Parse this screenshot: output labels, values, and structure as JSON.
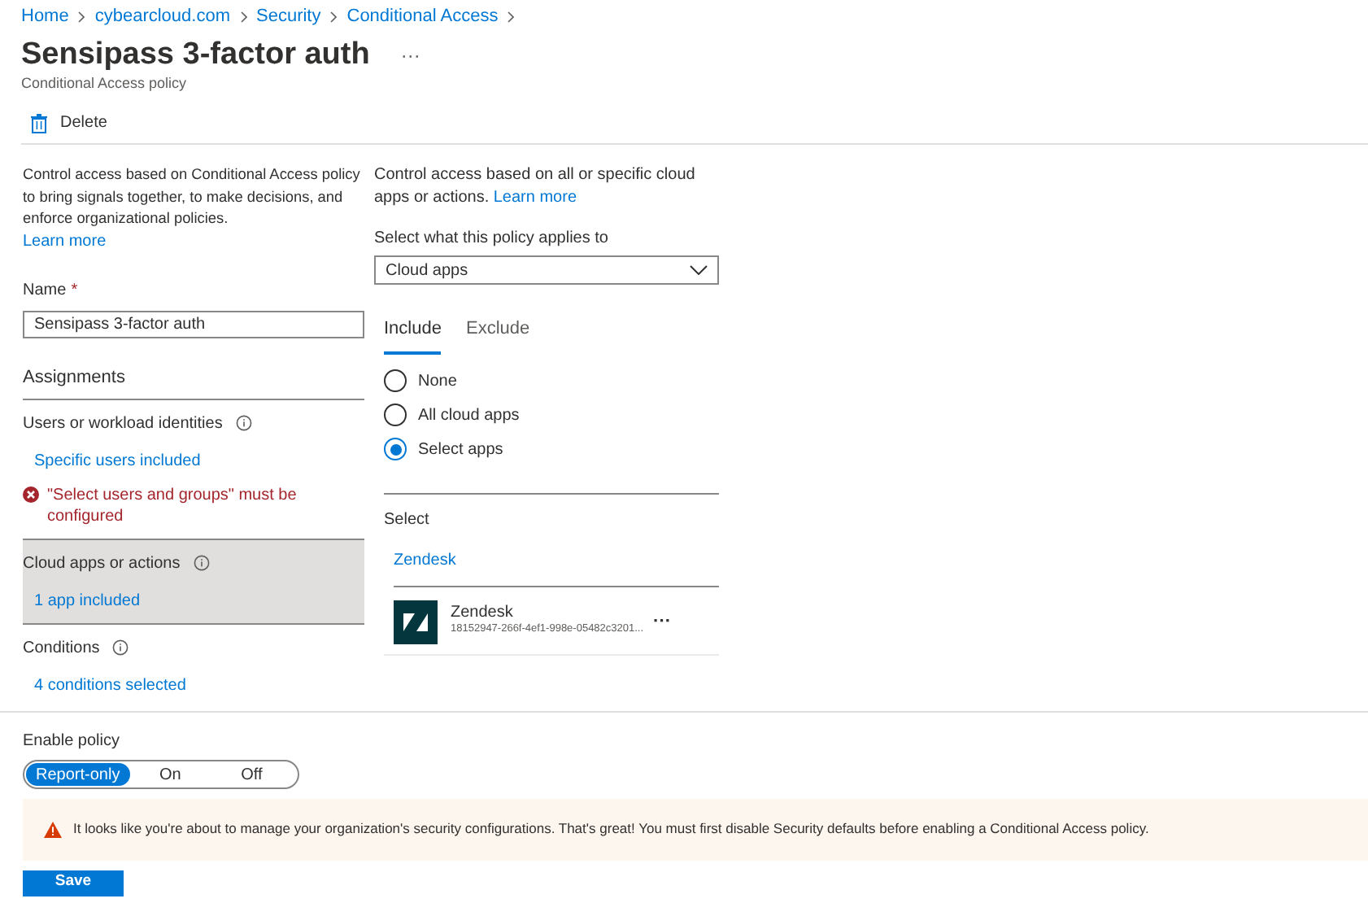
{
  "breadcrumb": [
    "Home",
    "cybearcloud.com",
    "Security",
    "Conditional Access"
  ],
  "title": "Sensipass 3-factor auth",
  "more": "···",
  "subtitle": "Conditional Access policy",
  "toolbar": [
    {
      "label": "Delete"
    }
  ],
  "left": {
    "intro": "Control access based on Conditional Access policy to bring signals together, to make decisions, and enforce organizational policies.",
    "learn_more": "Learn more",
    "name_label": "Name",
    "required_mark": "*",
    "name_value": "Sensipass 3-factor auth",
    "assignments_heading": "Assignments",
    "assignments": [
      {
        "label": "Users or workload identities",
        "link": "Specific users included",
        "error": "\"Select users and groups\" must be configured",
        "selected": false
      },
      {
        "label": "Cloud apps or actions",
        "link": "1 app included",
        "selected": true
      },
      {
        "label": "Conditions",
        "link": "4 conditions selected",
        "selected": false
      }
    ]
  },
  "right": {
    "intro": "Control access based on all or specific cloud apps or actions.",
    "learn_more": "Learn more",
    "applies_label": "Select what this policy applies to",
    "applies_value": "Cloud apps",
    "tabs": [
      {
        "label": "Include",
        "selected": true
      },
      {
        "label": "Exclude",
        "selected": false
      }
    ],
    "options": [
      {
        "label": "None",
        "selected": false
      },
      {
        "label": "All cloud apps",
        "selected": false
      },
      {
        "label": "Select apps",
        "selected": true
      }
    ],
    "select_label": "Select",
    "select_link": "Zendesk",
    "apps": [
      {
        "name": "Zendesk",
        "id": "18152947-266f-4ef1-998e-05482c3201...",
        "more": "···"
      }
    ]
  },
  "enable_policy": {
    "label": "Enable policy",
    "options": [
      {
        "label": "Report-only",
        "selected": true
      },
      {
        "label": "On",
        "selected": false
      },
      {
        "label": "Off",
        "selected": false
      }
    ]
  },
  "warning": "It looks like you're about to manage your organization's security configurations. That's great! You must first disable Security defaults before enabling a Conditional Access policy.",
  "save": "Save"
}
